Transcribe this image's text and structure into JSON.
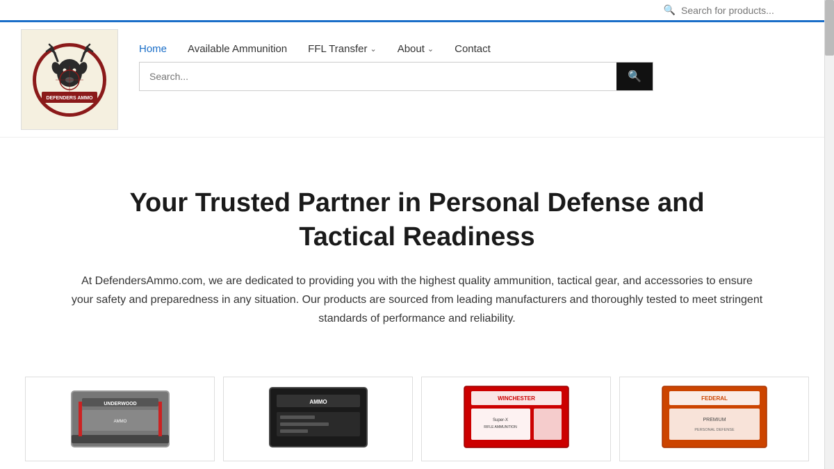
{
  "top_bar": {
    "search_placeholder": "Search for products..."
  },
  "header": {
    "logo_alt": "Defenders Ammo Logo",
    "nav": {
      "home": "Home",
      "available_ammunition": "Available Ammunition",
      "ffl_transfer": "FFL Transfer",
      "about": "About",
      "contact": "Contact"
    },
    "search": {
      "placeholder": "Search...",
      "button_label": "🔍"
    }
  },
  "hero": {
    "heading": "Your Trusted Partner in Personal Defense and Tactical Readiness",
    "body": "At DefendersAmmo.com, we are dedicated to providing you with the highest quality ammunition, tactical gear, and accessories to ensure your safety and preparedness in any situation. Our products are sourced from leading manufacturers and thoroughly tested to meet stringent standards of performance and reliability."
  },
  "products": [
    {
      "id": 1,
      "alt": "Underwood Ammo box",
      "style": "underwood"
    },
    {
      "id": 2,
      "alt": "Dark ammo box",
      "style": "dark"
    },
    {
      "id": 3,
      "alt": "Winchester ammo box",
      "style": "winchester"
    },
    {
      "id": 4,
      "alt": "Orange ammo box",
      "style": "orange"
    }
  ],
  "icons": {
    "search": "&#128269;",
    "chevron": "&#8964;",
    "search_btn": "&#128269;"
  }
}
